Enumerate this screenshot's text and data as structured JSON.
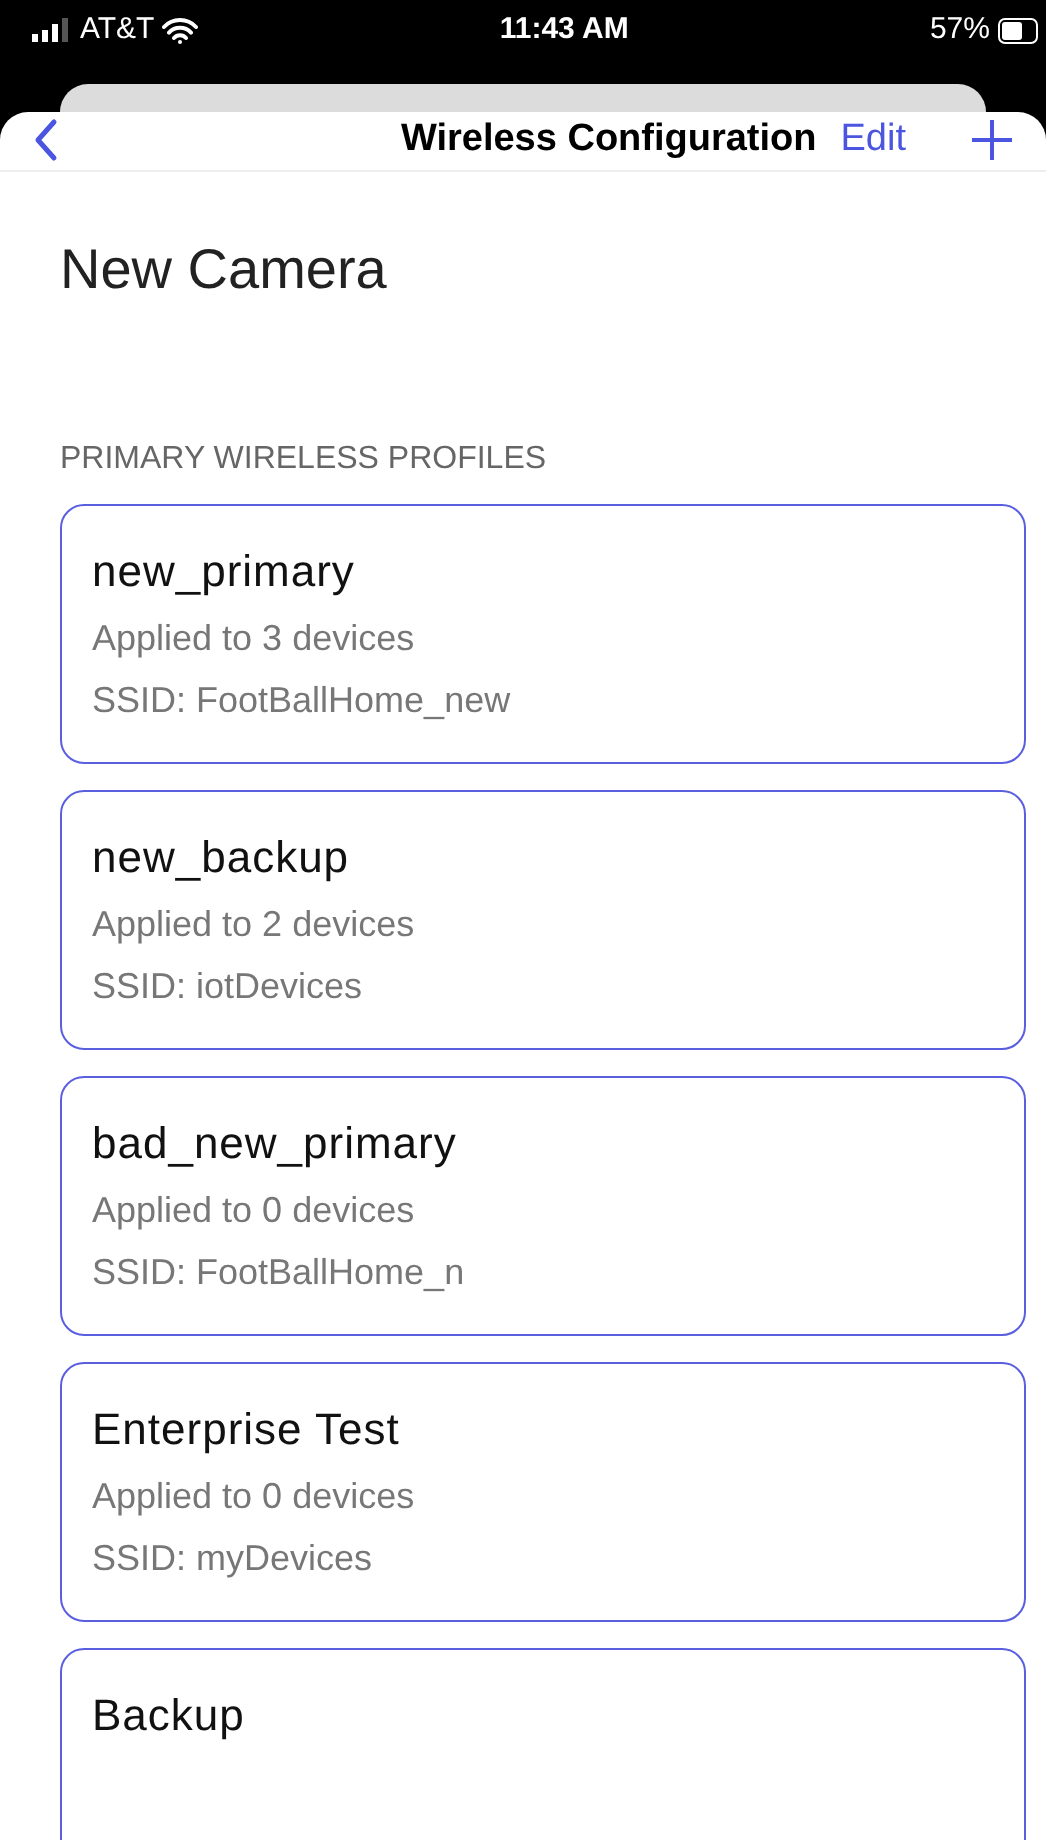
{
  "status_bar": {
    "carrier": "AT&T",
    "time": "11:43 AM",
    "battery": "57%"
  },
  "nav": {
    "title": "Wireless Configuration",
    "edit": "Edit"
  },
  "heading": "New Camera",
  "section": {
    "title": "PRIMARY WIRELESS PROFILES",
    "profiles": [
      {
        "name": "new_primary",
        "applied": "Applied to 3 devices",
        "ssid": "SSID: FootBallHome_new"
      },
      {
        "name": "new_backup",
        "applied": "Applied to 2 devices",
        "ssid": "SSID: iotDevices"
      },
      {
        "name": "bad_new_primary",
        "applied": "Applied to 0 devices",
        "ssid": "SSID: FootBallHome_n"
      },
      {
        "name": "Enterprise Test",
        "applied": "Applied to 0 devices",
        "ssid": "SSID: myDevices"
      },
      {
        "name": "Backup"
      }
    ]
  }
}
